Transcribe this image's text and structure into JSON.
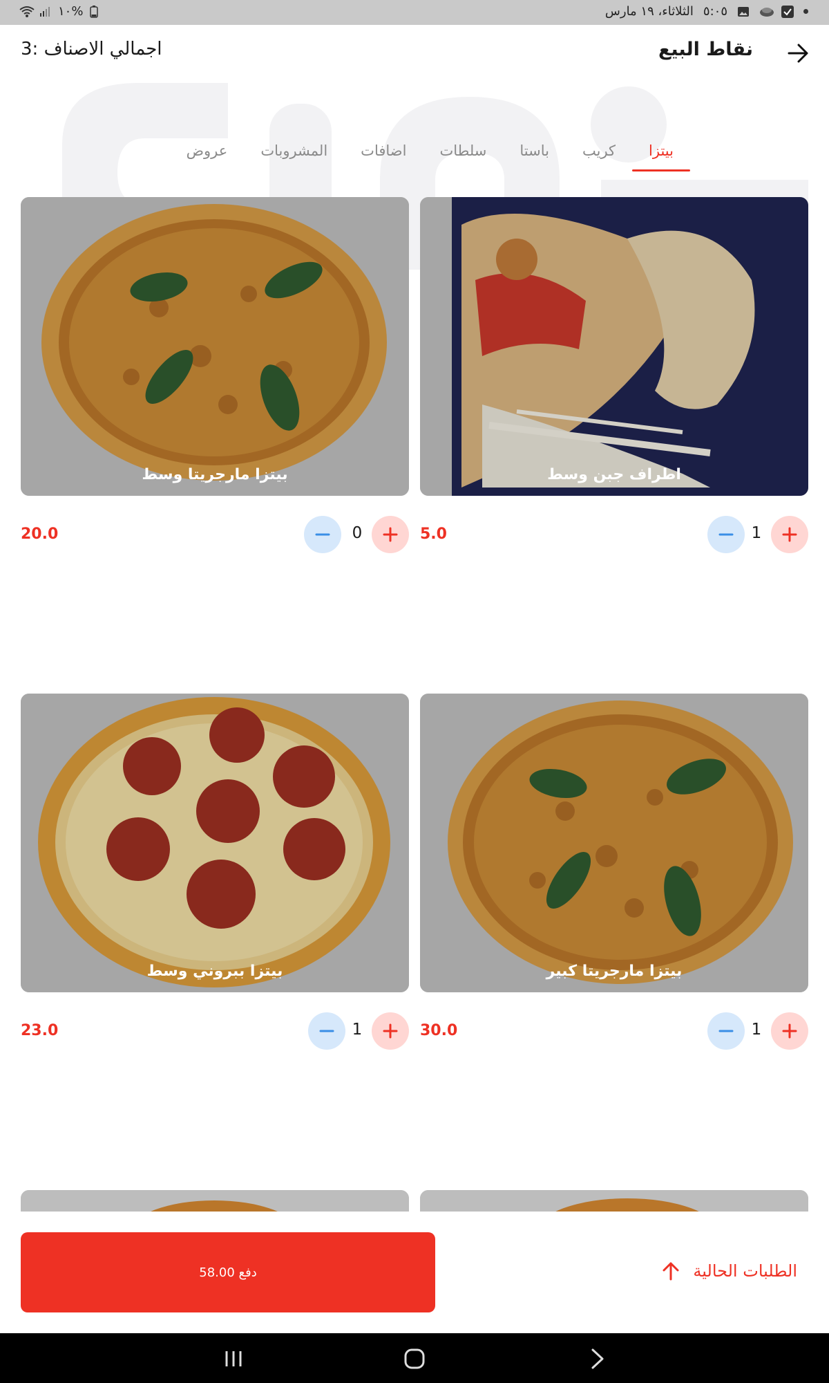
{
  "status_bar": {
    "date": "الثلاثاء، ١٩ مارس",
    "time": "٥:٠٥",
    "battery": "١٠%"
  },
  "header": {
    "title": "نقاط البيع",
    "total_label": "اجمالي الاصناف :3"
  },
  "tabs": [
    {
      "label": "بيتزا",
      "active": true
    },
    {
      "label": "كريب",
      "active": false
    },
    {
      "label": "باستا",
      "active": false
    },
    {
      "label": "سلطات",
      "active": false
    },
    {
      "label": "اضافات",
      "active": false
    },
    {
      "label": "المشروبات",
      "active": false
    },
    {
      "label": "عروض",
      "active": false
    }
  ],
  "products": [
    {
      "name": "اطراف جبن وسط",
      "price": "5.0",
      "quantity": "1"
    },
    {
      "name": "بيتزا مارجريتا وسط",
      "price": "20.0",
      "quantity": "0"
    },
    {
      "name": "بيتزا مارجريتا كبير",
      "price": "30.0",
      "quantity": "1"
    },
    {
      "name": "بيتزا ببروني وسط",
      "price": "23.0",
      "quantity": "1"
    }
  ],
  "bottom": {
    "pay_label": "دفع 58.00",
    "orders_label": "الطلبات الحالية"
  },
  "colors": {
    "accent": "#ee3124",
    "plus_bg": "#ffd6d3",
    "minus_bg": "#d6e8fb"
  }
}
